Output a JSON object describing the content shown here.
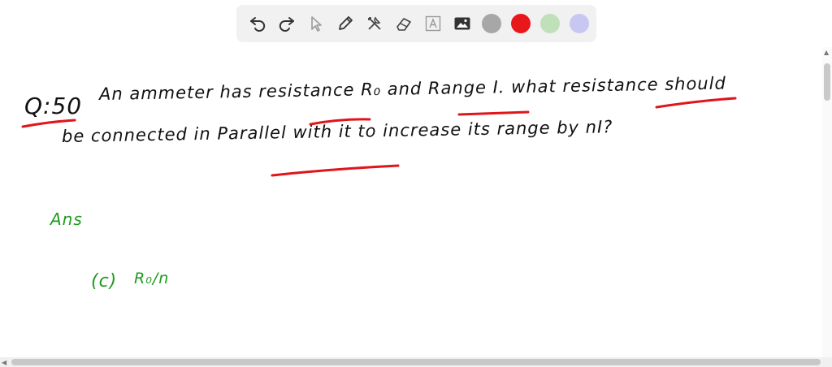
{
  "toolbar": {
    "tools": [
      {
        "name": "undo-icon"
      },
      {
        "name": "redo-icon"
      },
      {
        "name": "pointer-icon"
      },
      {
        "name": "pen-icon"
      },
      {
        "name": "tools-icon"
      },
      {
        "name": "eraser-icon"
      },
      {
        "name": "text-icon"
      },
      {
        "name": "image-icon"
      }
    ],
    "colors": [
      "#a7a7a7",
      "#e8171c",
      "#bfe0b8",
      "#c8c7f2"
    ]
  },
  "note": {
    "q_label": "Q:50",
    "line1": "An ammeter has resistance R₀ and Range I. what resistance should",
    "line2": "be connected in Parallel with it to increase its range by nI?",
    "ans_label": "Ans",
    "option": "(c)",
    "answer": "R₀/n"
  },
  "colors": {
    "ink": "#111111",
    "underline": "#e0151b",
    "answer": "#1f9a1f"
  }
}
